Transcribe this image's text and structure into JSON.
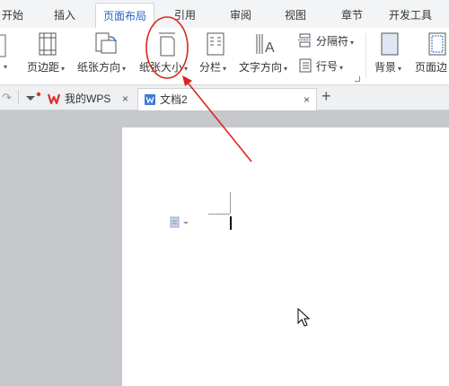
{
  "menu": {
    "tabs": [
      "开始",
      "插入",
      "页面布局",
      "引用",
      "审阅",
      "视图",
      "章节",
      "开发工具"
    ],
    "active": "页面布局"
  },
  "ribbon": {
    "margin_label": "页边距",
    "orientation_label": "纸张方向",
    "size_label": "纸张大小",
    "columns_label": "分栏",
    "text_direction_label": "文字方向",
    "separator_label": "分隔符",
    "line_number_label": "行号",
    "background_label": "背景",
    "page_border_label": "页面边"
  },
  "doc_tabs": {
    "wps_label": "我的WPS",
    "doc_label": "文档2",
    "close_glyph": "×",
    "add_glyph": "+"
  },
  "colors": {
    "accent": "#2b63c7",
    "annotation": "#d9261c",
    "wps_red": "#e0302a"
  }
}
